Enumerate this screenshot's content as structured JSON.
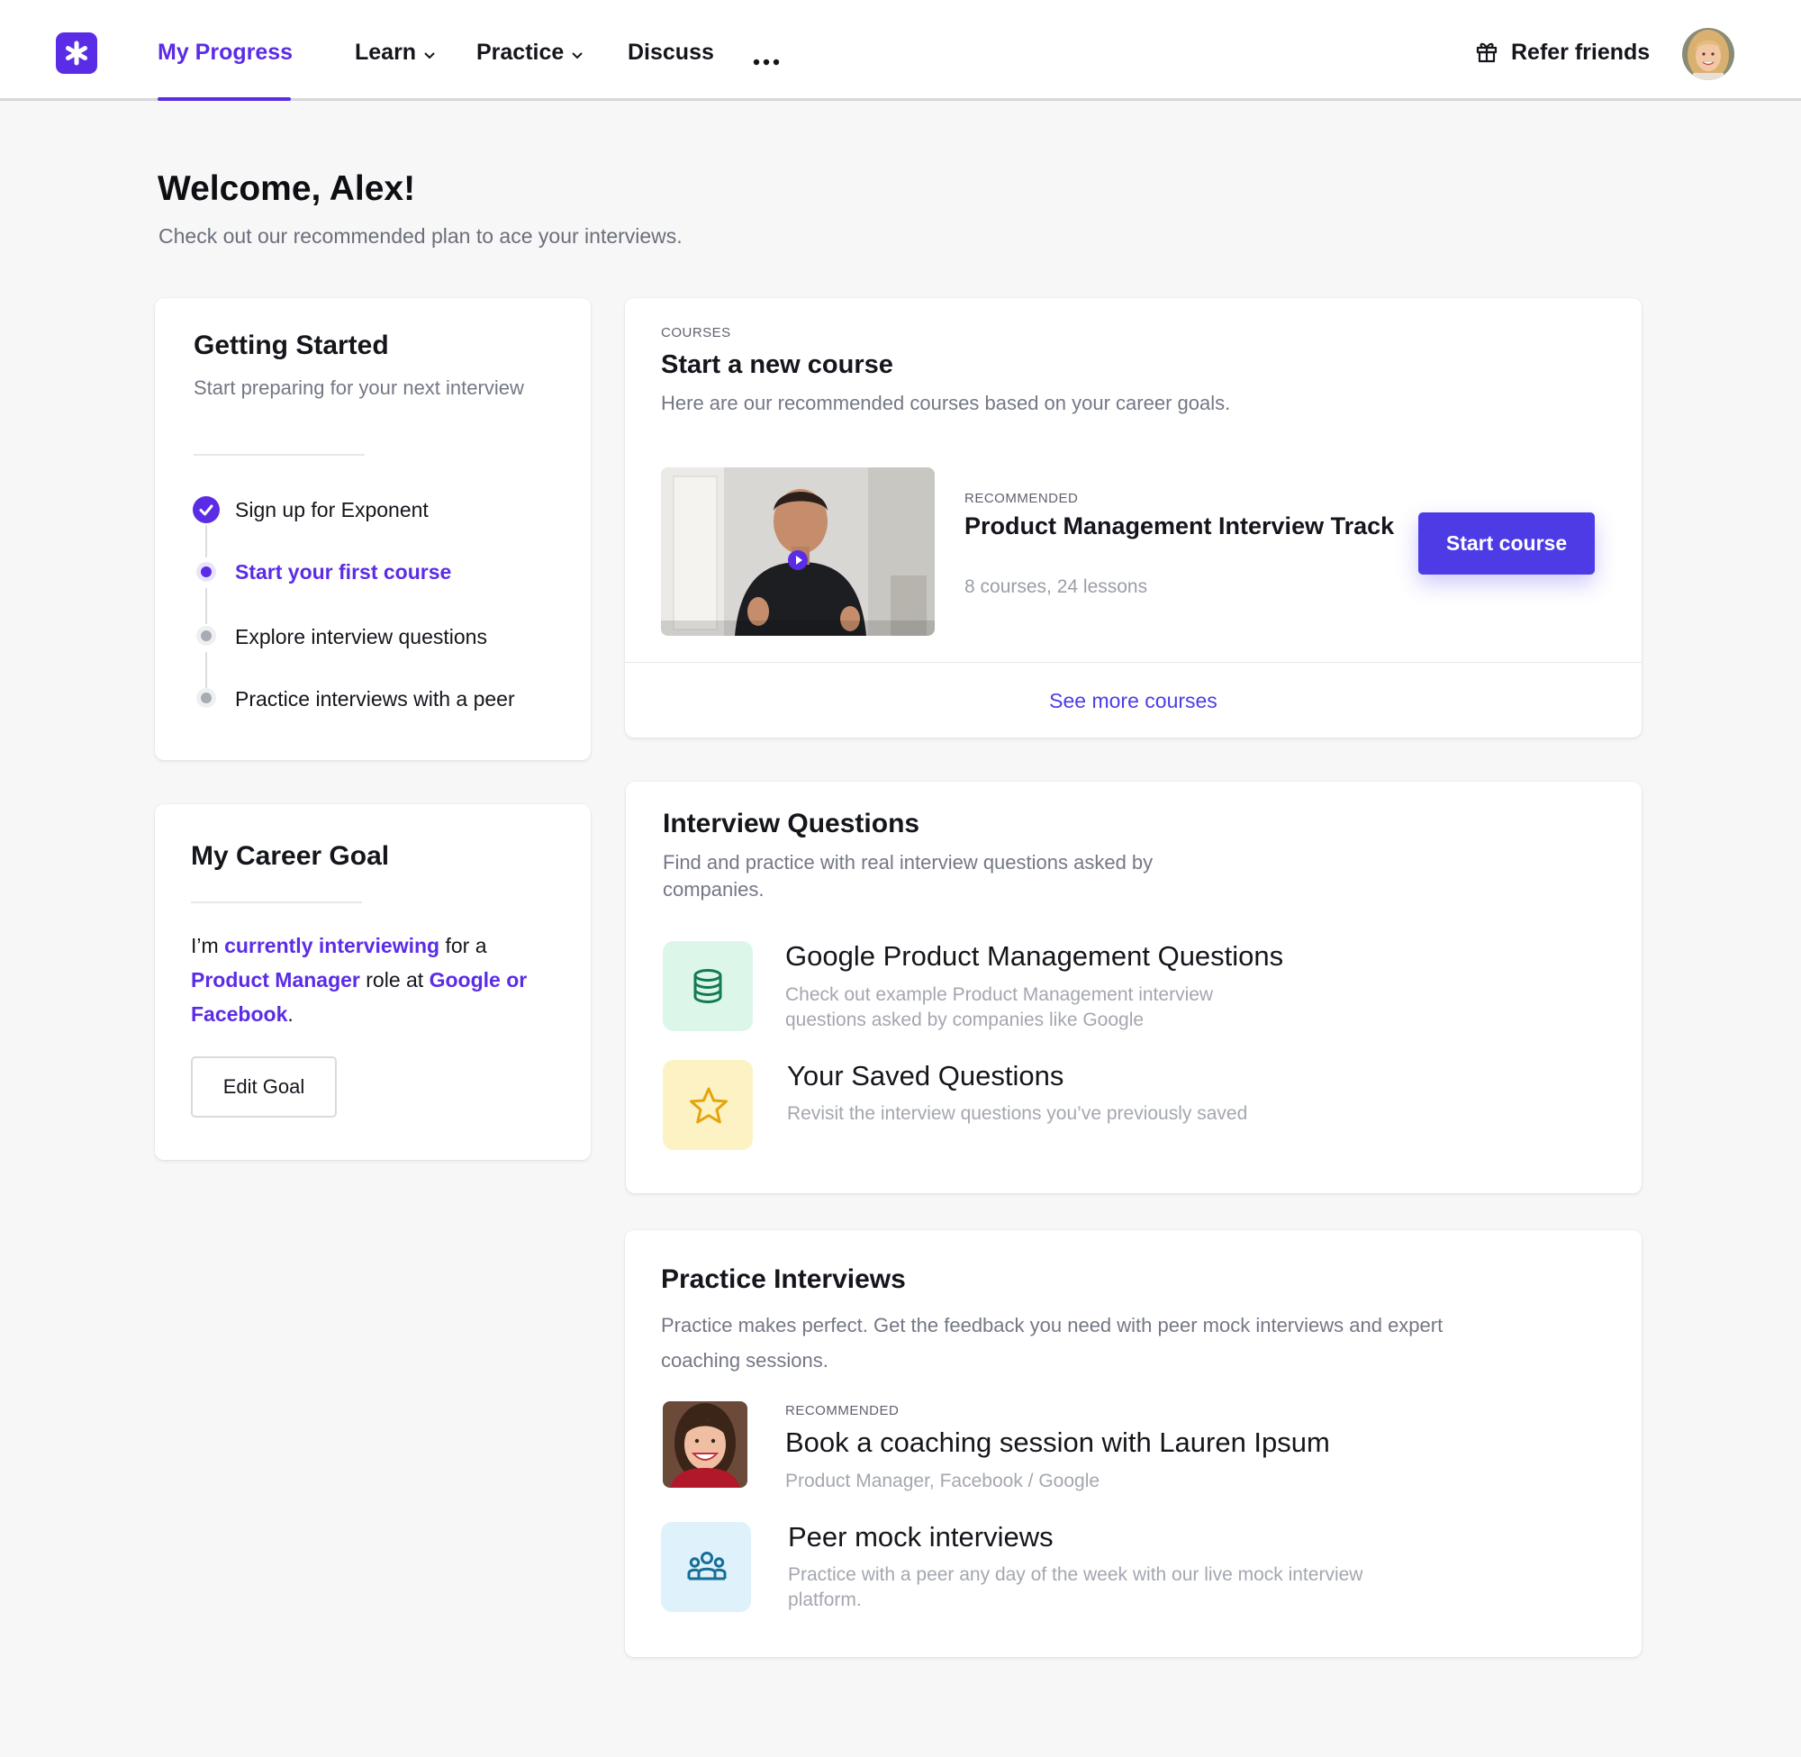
{
  "header": {
    "nav": {
      "my_progress": "My Progress",
      "learn": "Learn",
      "practice": "Practice",
      "discuss": "Discuss"
    },
    "refer_friends": "Refer friends"
  },
  "welcome": {
    "title": "Welcome, Alex!",
    "subtitle": "Check out our recommended plan to ace your interviews."
  },
  "getting_started": {
    "title": "Getting Started",
    "subtitle": "Start preparing for your next interview",
    "steps": [
      {
        "label": "Sign up for Exponent",
        "state": "done"
      },
      {
        "label": "Start your first course",
        "state": "current"
      },
      {
        "label": "Explore interview questions",
        "state": "todo"
      },
      {
        "label": "Practice interviews with a peer",
        "state": "todo"
      }
    ]
  },
  "career_goal": {
    "title": "My Career Goal",
    "text_1": "I’m ",
    "status": "currently interviewing",
    "text_2": " for a ",
    "role": "Product Manager",
    "text_3": " role at ",
    "companies": "Google or Facebook",
    "text_4": ".",
    "edit_button": "Edit Goal"
  },
  "courses": {
    "eyebrow": "COURSES",
    "title": "Start a new course",
    "subtitle": "Here are our recommended courses based on your career goals.",
    "recommended_label": "RECOMMENDED",
    "course_name": "Product Management Interview Track",
    "course_meta": "8 courses, 24 lessons",
    "start_button": "Start course",
    "see_more": "See more courses"
  },
  "interview_questions": {
    "title": "Interview Questions",
    "subtitle": "Find and practice with real interview questions asked by companies.",
    "items": [
      {
        "title": "Google Product Management Questions",
        "desc": "Check out example Product Management interview questions asked by companies like Google",
        "icon": "database-icon"
      },
      {
        "title": "Your Saved Questions",
        "desc": "Revisit the interview questions you’ve previously saved",
        "icon": "star-icon"
      }
    ]
  },
  "practice_interviews": {
    "title": "Practice Interviews",
    "subtitle": "Practice makes perfect. Get the feedback you need with peer mock interviews and expert coaching sessions.",
    "recommended_label": "RECOMMENDED",
    "coaching_title": "Book a coaching session with Lauren Ipsum",
    "coaching_meta": "Product Manager, Facebook / Google",
    "peer_title": "Peer mock interviews",
    "peer_desc": "Practice with a peer any day of the week with our live mock interview platform."
  },
  "colors": {
    "brand": "#5b2ce6",
    "button": "#4d3ce6",
    "green_tile": "#dcf7ea",
    "yellow_tile": "#fdf2c4",
    "blue_tile": "#dff1fb"
  }
}
